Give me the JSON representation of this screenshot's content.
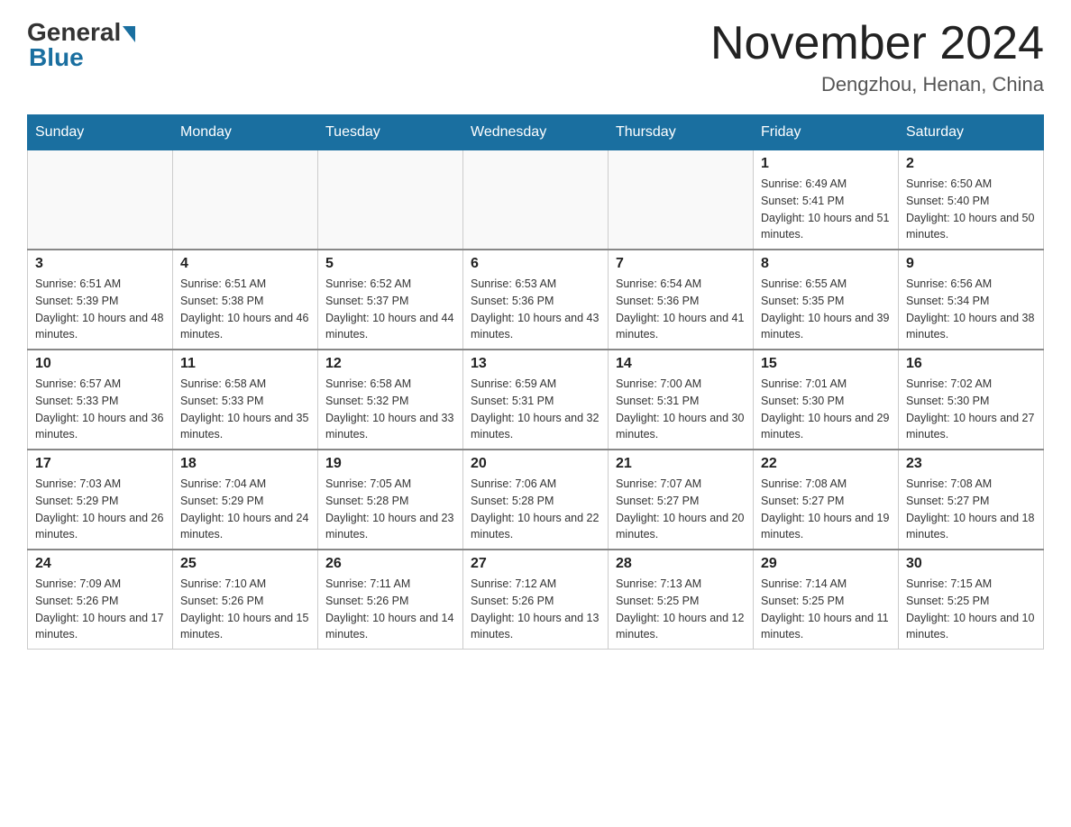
{
  "header": {
    "logo_general": "General",
    "logo_blue": "Blue",
    "month_title": "November 2024",
    "location": "Dengzhou, Henan, China"
  },
  "days_of_week": [
    "Sunday",
    "Monday",
    "Tuesday",
    "Wednesday",
    "Thursday",
    "Friday",
    "Saturday"
  ],
  "weeks": [
    [
      {
        "day": "",
        "info": ""
      },
      {
        "day": "",
        "info": ""
      },
      {
        "day": "",
        "info": ""
      },
      {
        "day": "",
        "info": ""
      },
      {
        "day": "",
        "info": ""
      },
      {
        "day": "1",
        "info": "Sunrise: 6:49 AM\nSunset: 5:41 PM\nDaylight: 10 hours and 51 minutes."
      },
      {
        "day": "2",
        "info": "Sunrise: 6:50 AM\nSunset: 5:40 PM\nDaylight: 10 hours and 50 minutes."
      }
    ],
    [
      {
        "day": "3",
        "info": "Sunrise: 6:51 AM\nSunset: 5:39 PM\nDaylight: 10 hours and 48 minutes."
      },
      {
        "day": "4",
        "info": "Sunrise: 6:51 AM\nSunset: 5:38 PM\nDaylight: 10 hours and 46 minutes."
      },
      {
        "day": "5",
        "info": "Sunrise: 6:52 AM\nSunset: 5:37 PM\nDaylight: 10 hours and 44 minutes."
      },
      {
        "day": "6",
        "info": "Sunrise: 6:53 AM\nSunset: 5:36 PM\nDaylight: 10 hours and 43 minutes."
      },
      {
        "day": "7",
        "info": "Sunrise: 6:54 AM\nSunset: 5:36 PM\nDaylight: 10 hours and 41 minutes."
      },
      {
        "day": "8",
        "info": "Sunrise: 6:55 AM\nSunset: 5:35 PM\nDaylight: 10 hours and 39 minutes."
      },
      {
        "day": "9",
        "info": "Sunrise: 6:56 AM\nSunset: 5:34 PM\nDaylight: 10 hours and 38 minutes."
      }
    ],
    [
      {
        "day": "10",
        "info": "Sunrise: 6:57 AM\nSunset: 5:33 PM\nDaylight: 10 hours and 36 minutes."
      },
      {
        "day": "11",
        "info": "Sunrise: 6:58 AM\nSunset: 5:33 PM\nDaylight: 10 hours and 35 minutes."
      },
      {
        "day": "12",
        "info": "Sunrise: 6:58 AM\nSunset: 5:32 PM\nDaylight: 10 hours and 33 minutes."
      },
      {
        "day": "13",
        "info": "Sunrise: 6:59 AM\nSunset: 5:31 PM\nDaylight: 10 hours and 32 minutes."
      },
      {
        "day": "14",
        "info": "Sunrise: 7:00 AM\nSunset: 5:31 PM\nDaylight: 10 hours and 30 minutes."
      },
      {
        "day": "15",
        "info": "Sunrise: 7:01 AM\nSunset: 5:30 PM\nDaylight: 10 hours and 29 minutes."
      },
      {
        "day": "16",
        "info": "Sunrise: 7:02 AM\nSunset: 5:30 PM\nDaylight: 10 hours and 27 minutes."
      }
    ],
    [
      {
        "day": "17",
        "info": "Sunrise: 7:03 AM\nSunset: 5:29 PM\nDaylight: 10 hours and 26 minutes."
      },
      {
        "day": "18",
        "info": "Sunrise: 7:04 AM\nSunset: 5:29 PM\nDaylight: 10 hours and 24 minutes."
      },
      {
        "day": "19",
        "info": "Sunrise: 7:05 AM\nSunset: 5:28 PM\nDaylight: 10 hours and 23 minutes."
      },
      {
        "day": "20",
        "info": "Sunrise: 7:06 AM\nSunset: 5:28 PM\nDaylight: 10 hours and 22 minutes."
      },
      {
        "day": "21",
        "info": "Sunrise: 7:07 AM\nSunset: 5:27 PM\nDaylight: 10 hours and 20 minutes."
      },
      {
        "day": "22",
        "info": "Sunrise: 7:08 AM\nSunset: 5:27 PM\nDaylight: 10 hours and 19 minutes."
      },
      {
        "day": "23",
        "info": "Sunrise: 7:08 AM\nSunset: 5:27 PM\nDaylight: 10 hours and 18 minutes."
      }
    ],
    [
      {
        "day": "24",
        "info": "Sunrise: 7:09 AM\nSunset: 5:26 PM\nDaylight: 10 hours and 17 minutes."
      },
      {
        "day": "25",
        "info": "Sunrise: 7:10 AM\nSunset: 5:26 PM\nDaylight: 10 hours and 15 minutes."
      },
      {
        "day": "26",
        "info": "Sunrise: 7:11 AM\nSunset: 5:26 PM\nDaylight: 10 hours and 14 minutes."
      },
      {
        "day": "27",
        "info": "Sunrise: 7:12 AM\nSunset: 5:26 PM\nDaylight: 10 hours and 13 minutes."
      },
      {
        "day": "28",
        "info": "Sunrise: 7:13 AM\nSunset: 5:25 PM\nDaylight: 10 hours and 12 minutes."
      },
      {
        "day": "29",
        "info": "Sunrise: 7:14 AM\nSunset: 5:25 PM\nDaylight: 10 hours and 11 minutes."
      },
      {
        "day": "30",
        "info": "Sunrise: 7:15 AM\nSunset: 5:25 PM\nDaylight: 10 hours and 10 minutes."
      }
    ]
  ]
}
